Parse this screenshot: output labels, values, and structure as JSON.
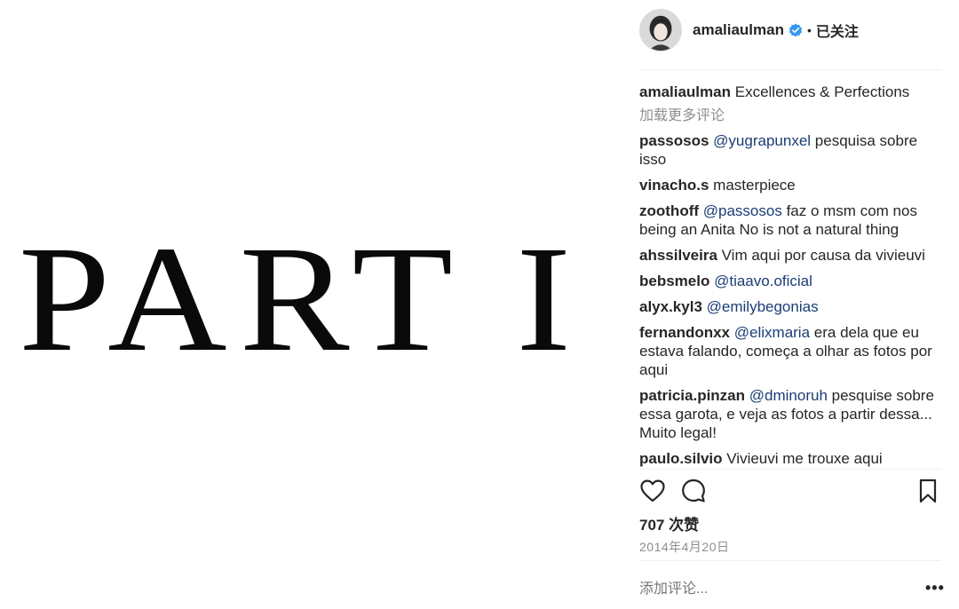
{
  "post": {
    "image_text": "PART I"
  },
  "header": {
    "username": "amaliaulman",
    "dot": "•",
    "follow_label": "已关注",
    "verified_color": "#3897f0"
  },
  "caption": {
    "username": "amaliaulman",
    "text": "Excellences & Perfections"
  },
  "load_more_label": "加载更多评论",
  "comments": [
    {
      "user": "passosos",
      "mention": "@yugrapunxel",
      "text": " pesquisa sobre isso"
    },
    {
      "user": "vinacho.s",
      "mention": "",
      "text": "masterpiece"
    },
    {
      "user": "zoothoff",
      "mention": "@passosos",
      "text": " faz o msm com nos being an Anita No is not a natural thing"
    },
    {
      "user": "ahssilveira",
      "mention": "",
      "text": "Vim aqui por causa da vivieuvi"
    },
    {
      "user": "bebsmelo",
      "mention": "@tiaavo.oficial",
      "text": ""
    },
    {
      "user": "alyx.kyl3",
      "mention": "@emilybegonias",
      "text": ""
    },
    {
      "user": "fernandonxx",
      "mention": "@elixmaria",
      "text": " era dela que eu estava falando, começa a olhar as fotos por aqui"
    },
    {
      "user": "patricia.pinzan",
      "mention": "@dminoruh",
      "text": " pesquise sobre essa garota, e veja as fotos a partir dessa... Muito legal!"
    },
    {
      "user": "paulo.silvio",
      "mention": "",
      "text": "Vivieuvi me trouxe aqui"
    }
  ],
  "likes_label": "707 次赞",
  "date": "2014年4月20日",
  "add_comment_placeholder": "添加评论...",
  "more_label": "•••",
  "colors": {
    "mention": "#1b3d75",
    "muted": "#8e8e8e",
    "text": "#262626"
  },
  "icons": [
    "heart-icon",
    "comment-icon",
    "bookmark-icon",
    "verified-badge-icon",
    "more-options-icon"
  ]
}
